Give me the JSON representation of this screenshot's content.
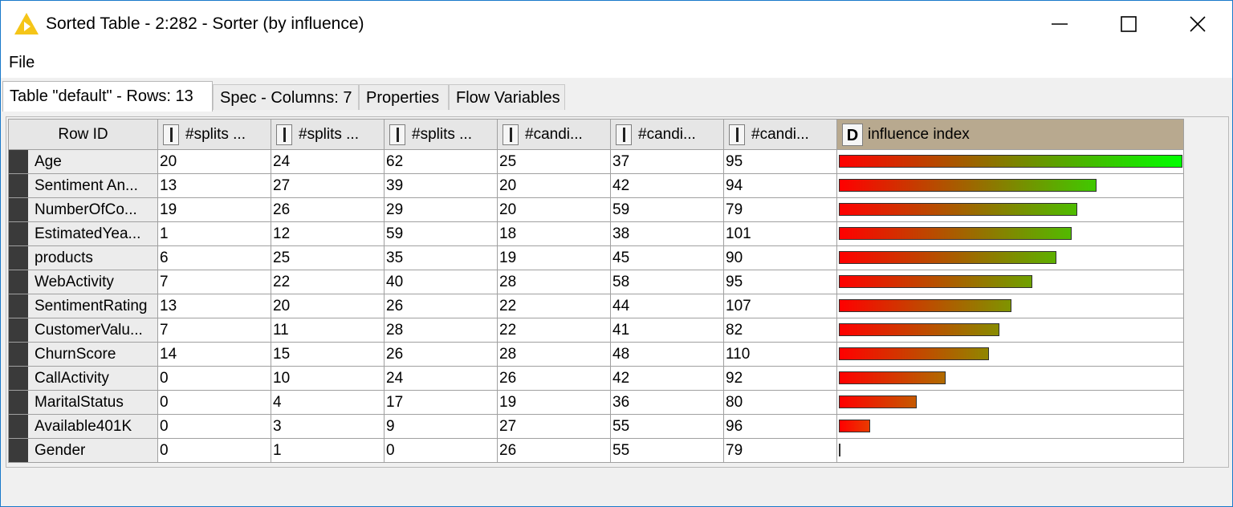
{
  "window": {
    "title": "Sorted Table - 2:282 - Sorter (by influence)",
    "accent_color": "#f5c518"
  },
  "menu": {
    "file_label": "File"
  },
  "tabs": [
    {
      "label": "Table \"default\" - Rows: 13",
      "active": true
    },
    {
      "label": "Spec - Columns: 7",
      "active": false
    },
    {
      "label": "Properties",
      "active": false
    },
    {
      "label": "Flow Variables",
      "active": false
    }
  ],
  "table": {
    "rowid_header": "Row ID",
    "columns": [
      {
        "label": "#splits ..."
      },
      {
        "label": "#splits ..."
      },
      {
        "label": "#splits ..."
      },
      {
        "label": "#candi..."
      },
      {
        "label": "#candi..."
      },
      {
        "label": "#candi..."
      }
    ],
    "influence_header": "influence index",
    "influence_type": "D",
    "rows": [
      {
        "id": "Age",
        "values": [
          "20",
          "24",
          "62",
          "25",
          "37",
          "95"
        ],
        "influence": 1.0
      },
      {
        "id": "Sentiment An...",
        "values": [
          "13",
          "27",
          "39",
          "20",
          "42",
          "94"
        ],
        "influence": 0.75
      },
      {
        "id": "NumberOfCo...",
        "values": [
          "19",
          "26",
          "29",
          "20",
          "59",
          "79"
        ],
        "influence": 0.695
      },
      {
        "id": "EstimatedYea...",
        "values": [
          "1",
          "12",
          "59",
          "18",
          "38",
          "101"
        ],
        "influence": 0.678
      },
      {
        "id": "products",
        "values": [
          "6",
          "25",
          "35",
          "19",
          "45",
          "90"
        ],
        "influence": 0.633
      },
      {
        "id": "WebActivity",
        "values": [
          "7",
          "22",
          "40",
          "28",
          "58",
          "95"
        ],
        "influence": 0.563
      },
      {
        "id": "SentimentRating",
        "values": [
          "13",
          "20",
          "26",
          "22",
          "44",
          "107"
        ],
        "influence": 0.503
      },
      {
        "id": "CustomerValu...",
        "values": [
          "7",
          "11",
          "28",
          "22",
          "41",
          "82"
        ],
        "influence": 0.467
      },
      {
        "id": "ChurnScore",
        "values": [
          "14",
          "15",
          "26",
          "28",
          "48",
          "110"
        ],
        "influence": 0.437
      },
      {
        "id": "CallActivity",
        "values": [
          "0",
          "10",
          "24",
          "26",
          "42",
          "92"
        ],
        "influence": 0.31
      },
      {
        "id": "MaritalStatus",
        "values": [
          "0",
          "4",
          "17",
          "19",
          "36",
          "80"
        ],
        "influence": 0.226
      },
      {
        "id": "Available401K",
        "values": [
          "0",
          "3",
          "9",
          "27",
          "55",
          "96"
        ],
        "influence": 0.091
      },
      {
        "id": "Gender",
        "values": [
          "0",
          "1",
          "0",
          "26",
          "55",
          "79"
        ],
        "influence": 0.0
      }
    ]
  }
}
